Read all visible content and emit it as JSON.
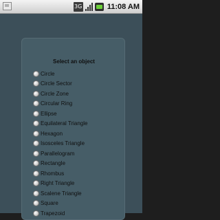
{
  "status_bar": {
    "network_label": "3G",
    "time": "11:08 AM",
    "icons": [
      "notification-icon",
      "3g-icon",
      "signal-icon",
      "battery-icon"
    ]
  },
  "dialog": {
    "title": "Select an object",
    "options": [
      {
        "label": "Circle"
      },
      {
        "label": "Circle Sector"
      },
      {
        "label": "Circle Zone"
      },
      {
        "label": "Circular Ring"
      },
      {
        "label": "Ellipse"
      },
      {
        "label": "Equilateral Triangle"
      },
      {
        "label": "Hexagon"
      },
      {
        "label": "Isosceles Triangle"
      },
      {
        "label": "Parallelogram"
      },
      {
        "label": "Rectangle"
      },
      {
        "label": "Rhombus"
      },
      {
        "label": "Right Triangle"
      },
      {
        "label": "Scalene Triangle"
      },
      {
        "label": "Square"
      },
      {
        "label": "Trapezoid"
      }
    ]
  },
  "colors": {
    "background": "#3c4f59",
    "dialog_bg": "#465d67",
    "text": "#101010"
  }
}
